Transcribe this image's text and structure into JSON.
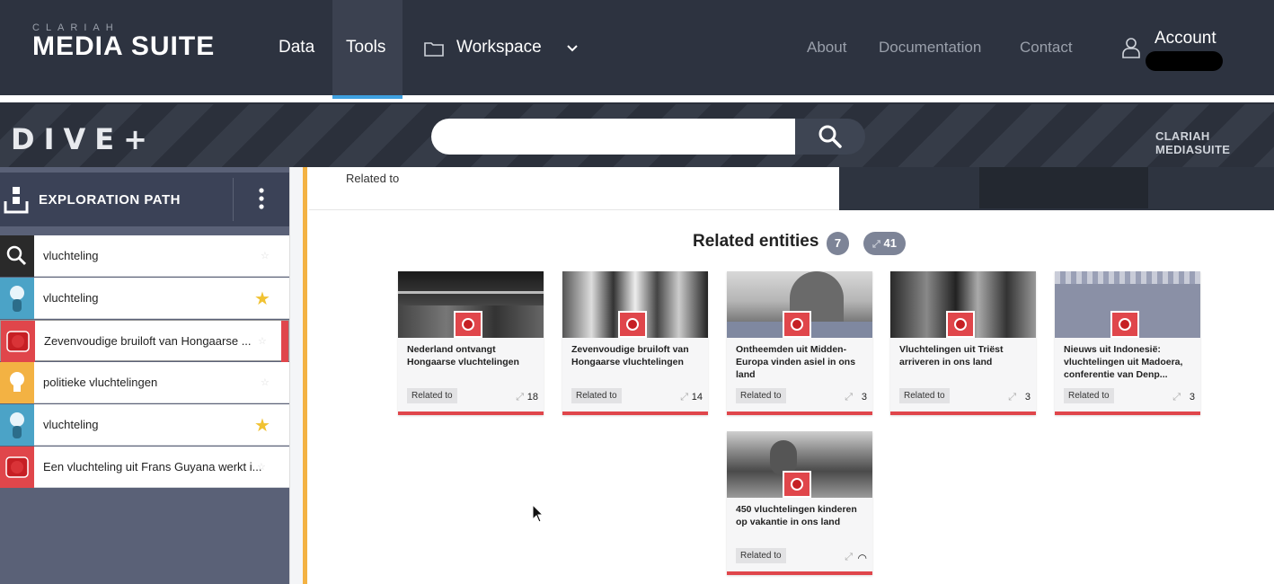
{
  "topnav": {
    "logo_small": "CLARIAH",
    "logo_big": "MEDIA SUITE",
    "items": [
      "Data",
      "Tools"
    ],
    "workspace": "Workspace",
    "right_links": [
      "About",
      "Documentation",
      "Contact"
    ],
    "account_label": "Account",
    "active_tab": "Tools",
    "accent_color": "#3ea0e0"
  },
  "divebar": {
    "logo": "DIVE+",
    "search_placeholder": "",
    "brand": "CLARIAH MEDIASUITE"
  },
  "sidebar": {
    "title": "EXPLORATION PATH",
    "items": [
      {
        "type": "search",
        "label": "vluchteling",
        "starred": false
      },
      {
        "type": "person",
        "label": "vluchteling",
        "starred": true
      },
      {
        "type": "media",
        "label": "Zevenvoudige bruiloft van Hongaarse ...",
        "starred": false,
        "active": true
      },
      {
        "type": "concept",
        "label": "politieke vluchtelingen",
        "starred": false
      },
      {
        "type": "person",
        "label": "vluchteling",
        "starred": true
      },
      {
        "type": "media",
        "label": "Een vluchteling uit Frans Guyana werkt i...",
        "starred": false
      }
    ]
  },
  "related_panel": {
    "label": "Related to"
  },
  "related": {
    "title": "Related entities",
    "count": "7",
    "links": "41",
    "cards": [
      {
        "title": "Nederland ontvangt Hongaarse vluchtelingen",
        "rel": "Related to",
        "count": "18"
      },
      {
        "title": "Zevenvoudige bruiloft van Hongaarse vluchtelingen",
        "rel": "Related to",
        "count": "14"
      },
      {
        "title": "Ontheemden uit Midden-Europa vinden asiel in ons land",
        "rel": "Related to",
        "count": "3"
      },
      {
        "title": "Vluchtelingen uit Triëst arriveren in ons land",
        "rel": "Related to",
        "count": "3"
      },
      {
        "title": "Nieuws uit Indonesië: vluchtelingen uit Madoera, conferentie van Denp...",
        "rel": "Related to",
        "count": "3"
      },
      {
        "title": "450 vluchtelingen kinderen op vakantie in ons land",
        "rel": "Related to",
        "count": ""
      }
    ]
  },
  "colors": {
    "media": "#e0464b",
    "person": "#4ba3c7",
    "concept": "#f3b243",
    "search": "#2a2a2a"
  }
}
